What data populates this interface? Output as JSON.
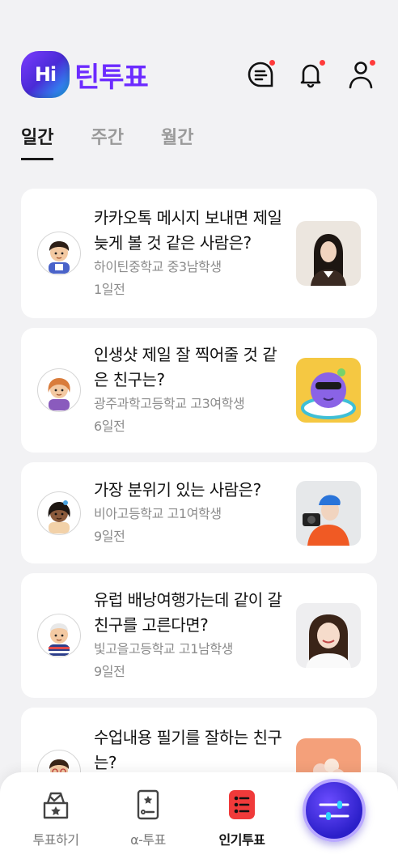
{
  "header": {
    "logo_badge": "Hi",
    "logo_text": "틴투표",
    "icons": [
      "chat-list-icon",
      "bell-icon",
      "profile-icon"
    ]
  },
  "tabs": [
    {
      "label": "일간",
      "active": true
    },
    {
      "label": "주간",
      "active": false
    },
    {
      "label": "월간",
      "active": false
    }
  ],
  "polls": [
    {
      "question": "카카오톡 메시지 보내면 제일 늦게 볼 것 같은 사람은?",
      "school": "하이틴중학교 중3남학생",
      "time": "1일전"
    },
    {
      "question": "인생샷 제일 잘 찍어줄 것 같은 친구는?",
      "school": "광주과학고등학교 고3여학생",
      "time": "6일전"
    },
    {
      "question": "가장 분위기 있는 사람은?",
      "school": "비아고등학교 고1여학생",
      "time": "9일전"
    },
    {
      "question": "유럽 배낭여행가는데 같이 갈 친구를 고른다면?",
      "school": "빛고을고등학교 고1남학생",
      "time": "9일전"
    },
    {
      "question": "수업내용 필기를 잘하는 친구는?",
      "school": "",
      "time": ""
    }
  ],
  "bottom_nav": [
    {
      "label": "투표하기",
      "icon": "vote-box-icon",
      "active": false
    },
    {
      "label": "α-투표",
      "icon": "card-icon",
      "active": false
    },
    {
      "label": "인기투표",
      "icon": "popular-list-icon",
      "active": true
    }
  ],
  "colors": {
    "brand": "#6c2bff",
    "notification_dot": "#ff3b3b",
    "active_nav": "#f03a3a"
  }
}
